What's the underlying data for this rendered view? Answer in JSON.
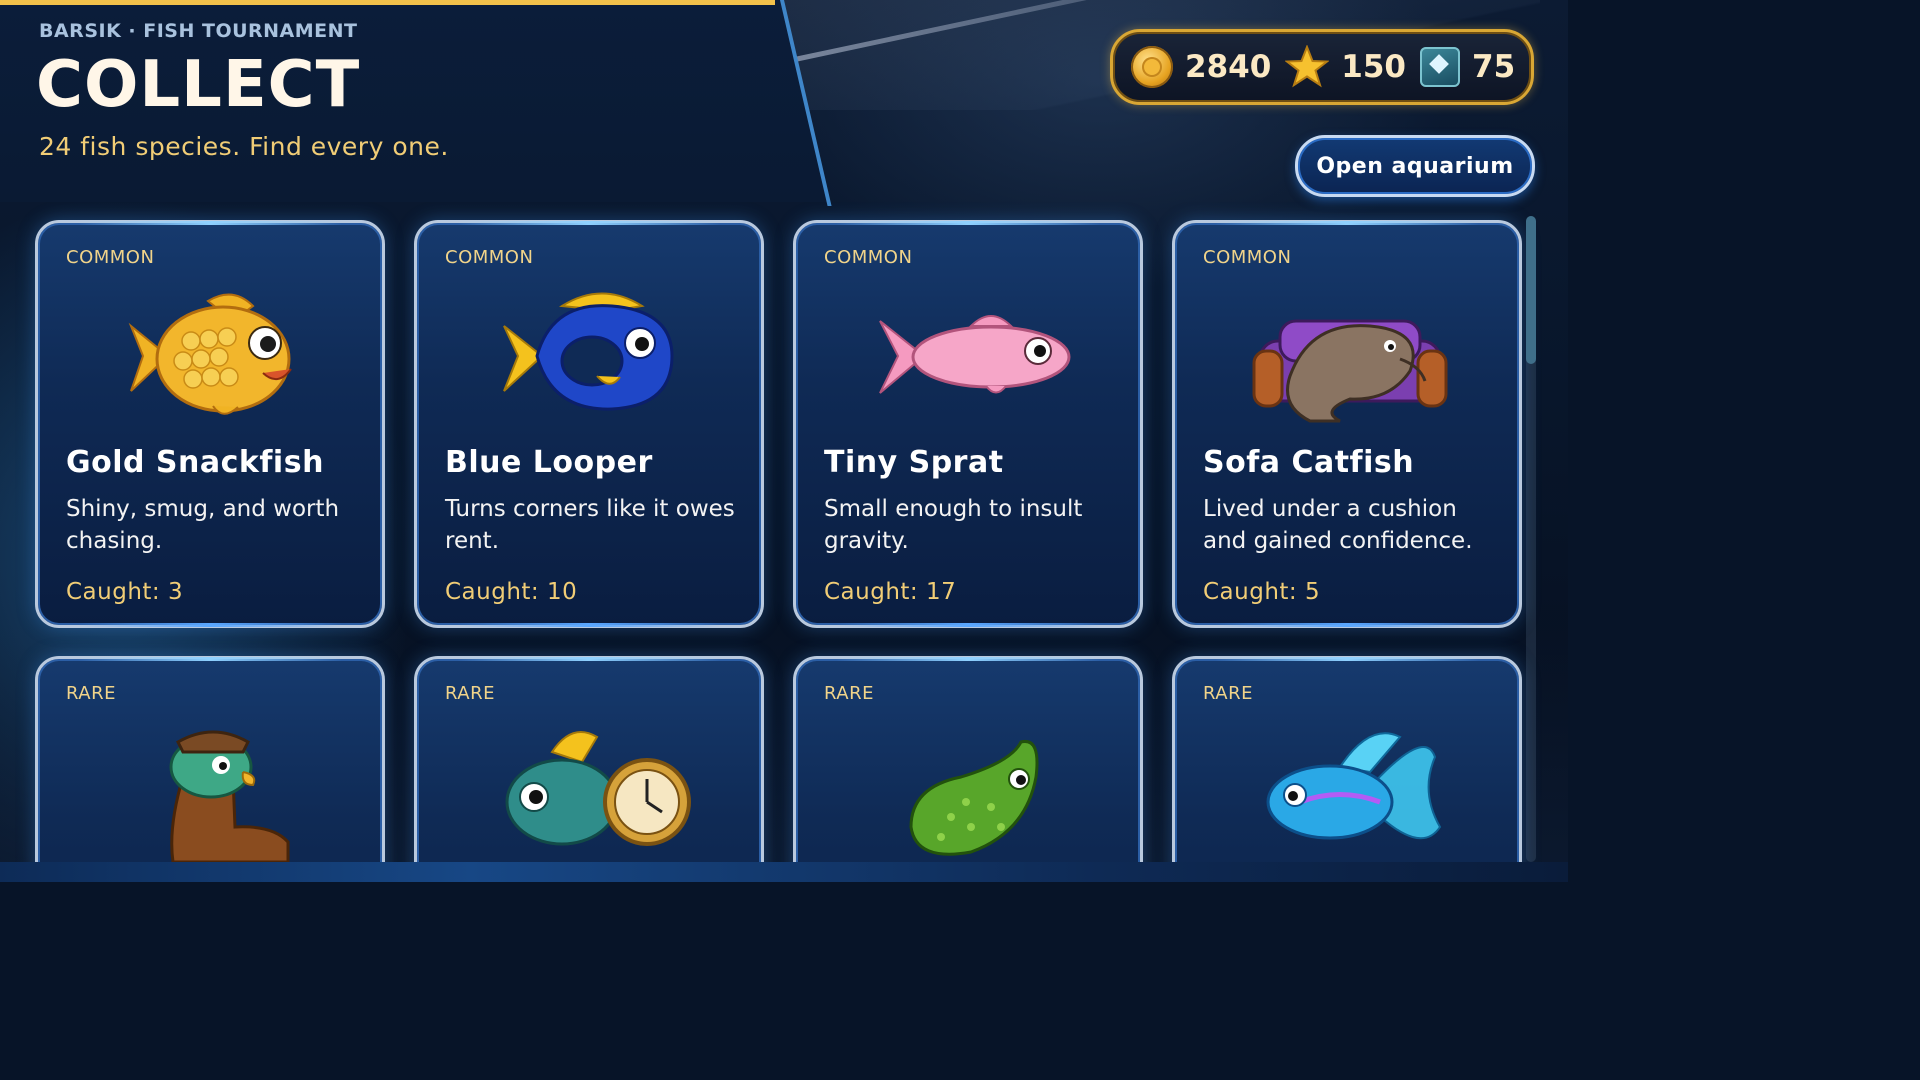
{
  "header": {
    "breadcrumb": "BARSIK · FISH TOURNAMENT",
    "title": "COLLECT",
    "subtitle": "24 fish species. Find every one."
  },
  "currency": {
    "coins": "2840",
    "stars": "150",
    "gems": "75",
    "coin_icon": "gold-coin-icon",
    "star_icon": "star-icon",
    "gem_icon": "gem-icon"
  },
  "actions": {
    "open_aquarium": "Open aquarium"
  },
  "cards": [
    {
      "rarity": "COMMON",
      "name": "Gold Snackfish",
      "desc": "Shiny, smug, and worth chasing.",
      "caught": "Caught: 3",
      "icon": "gold-snackfish-icon"
    },
    {
      "rarity": "COMMON",
      "name": "Blue Looper",
      "desc": "Turns corners like it owes rent.",
      "caught": "Caught: 10",
      "icon": "blue-looper-icon"
    },
    {
      "rarity": "COMMON",
      "name": "Tiny Sprat",
      "desc": "Small enough to insult gravity.",
      "caught": "Caught: 17",
      "icon": "tiny-sprat-icon"
    },
    {
      "rarity": "COMMON",
      "name": "Sofa Catfish",
      "desc": "Lived under a cushion and gained confidence.",
      "caught": "Caught: 5",
      "icon": "sofa-catfish-icon"
    },
    {
      "rarity": "RARE",
      "icon": "boot-fish-icon"
    },
    {
      "rarity": "RARE",
      "icon": "clock-fish-icon"
    },
    {
      "rarity": "RARE",
      "icon": "pickle-fish-icon"
    },
    {
      "rarity": "RARE",
      "icon": "neon-fish-icon"
    }
  ],
  "colors": {
    "accent_gold": "#f2c14b",
    "panel_blue": "#0b1d3a",
    "card_blue": "#163a6e"
  }
}
